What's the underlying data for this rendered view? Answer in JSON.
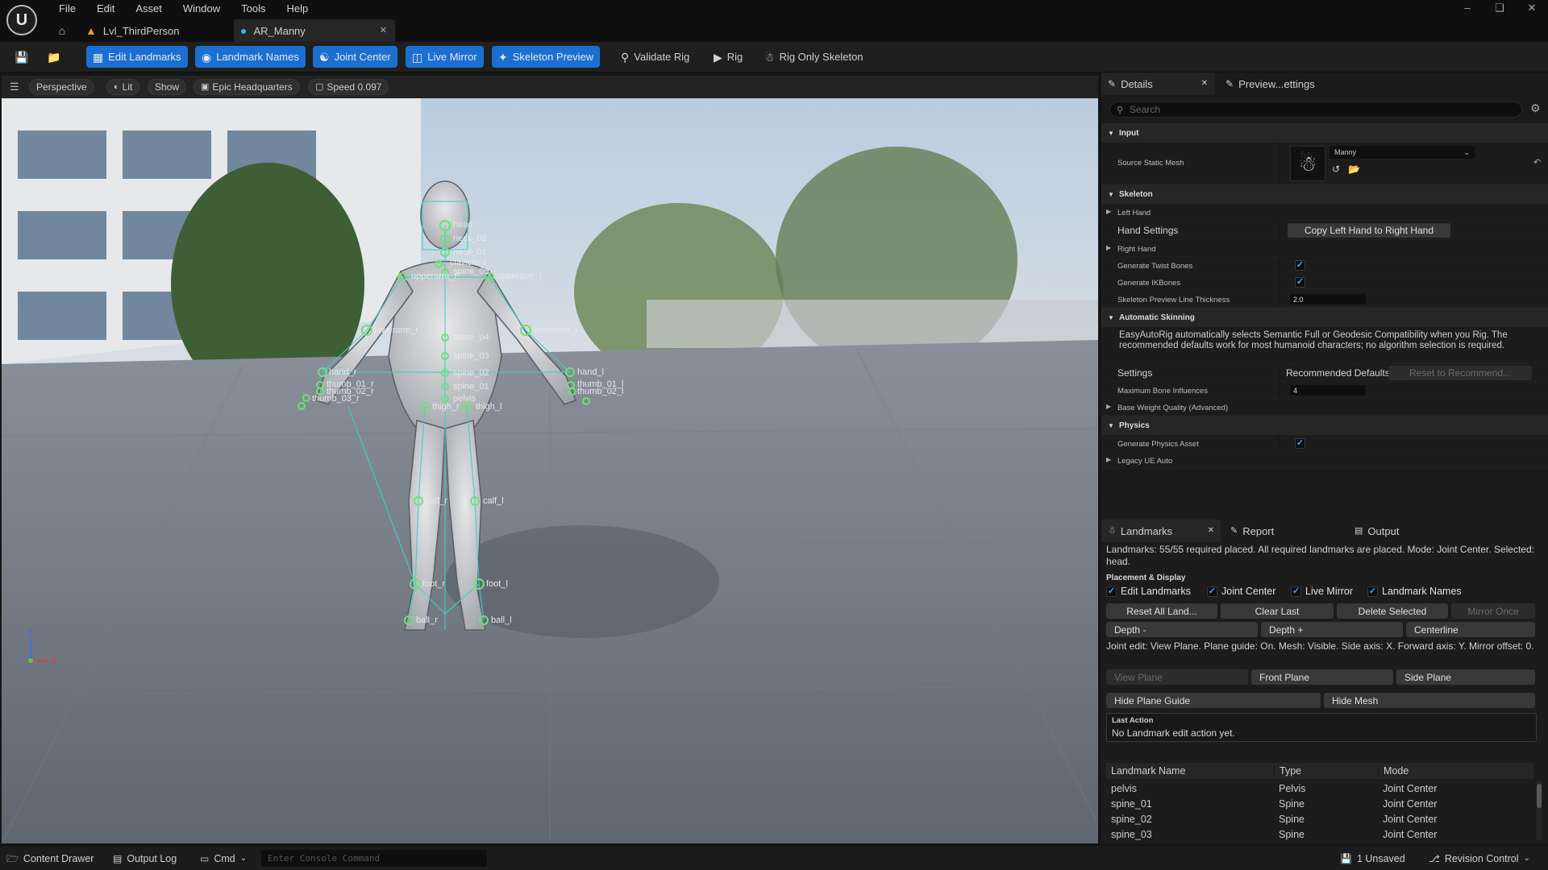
{
  "titlebar": {
    "menu": [
      "File",
      "Edit",
      "Asset",
      "Window",
      "Tools",
      "Help"
    ],
    "tabs": [
      {
        "label": "Lvl_ThirdPerson",
        "icon": "level-icon"
      },
      {
        "label": "AR_Manny",
        "icon": "asset-icon"
      }
    ]
  },
  "toolbar": {
    "edit_landmarks": "Edit Landmarks",
    "landmark_names": "Landmark Names",
    "joint_center": "Joint Center",
    "live_mirror": "Live Mirror",
    "skeleton_preview": "Skeleton Preview",
    "validate_rig": "Validate Rig",
    "rig": "Rig",
    "rig_only_skeleton": "Rig Only Skeleton"
  },
  "viewport": {
    "perspective": "Perspective",
    "lit": "Lit",
    "show": "Show",
    "environment": "Epic Headquarters",
    "speed": "Speed 0.097",
    "axis_z": "Z",
    "axis_x": "X",
    "landmarks": [
      {
        "name": "head"
      },
      {
        "name": "neck_02"
      },
      {
        "name": "neck_01"
      },
      {
        "name": "clavicle_l"
      },
      {
        "name": "spine_05"
      },
      {
        "name": "upperarm_r"
      },
      {
        "name": "upperarm_l"
      },
      {
        "name": "lowerarm_r"
      },
      {
        "name": "lowerarm_l"
      },
      {
        "name": "spine_04"
      },
      {
        "name": "spine_03"
      },
      {
        "name": "spine_02"
      },
      {
        "name": "spine_01"
      },
      {
        "name": "pelvis"
      },
      {
        "name": "hand_r"
      },
      {
        "name": "hand_l"
      },
      {
        "name": "thumb_01_r"
      },
      {
        "name": "thumb_02_r"
      },
      {
        "name": "thumb_03_r"
      },
      {
        "name": "thumb_01_l"
      },
      {
        "name": "thumb_02_l"
      },
      {
        "name": "thigh_r"
      },
      {
        "name": "thigh_l"
      },
      {
        "name": "calf_r"
      },
      {
        "name": "calf_l"
      },
      {
        "name": "foot_r"
      },
      {
        "name": "foot_l"
      },
      {
        "name": "ball_r"
      },
      {
        "name": "ball_l"
      }
    ]
  },
  "details": {
    "tab_details": "Details",
    "tab_preview": "Preview...ettings",
    "search_placeholder": "Search",
    "input_section": "Input",
    "source_static_mesh": "Source Static Mesh",
    "mesh_value": "Manny",
    "skeleton_section": "Skeleton",
    "left_hand": "Left Hand",
    "hand_settings": "Hand Settings",
    "copy_hand": "Copy Left Hand to Right Hand",
    "right_hand": "Right Hand",
    "generate_twist": "Generate Twist Bones",
    "generate_twist_checked": true,
    "generate_ik": "Generate IKBones",
    "generate_ik_checked": true,
    "line_thickness_label": "Skeleton Preview Line Thickness",
    "line_thickness_value": "2.0",
    "auto_skinning_section": "Automatic Skinning",
    "auto_skinning_text": "EasyAutoRig automatically selects Semantic Full or Geodesic Compatibility when you Rig. The recommended defaults work for most humanoid characters; no algorithm selection is required.",
    "settings": "Settings",
    "recommended_defaults": "Recommended Defaults",
    "reset_recommend": "Reset to Recommend...",
    "max_bone_influences_label": "Maximum Bone Influences",
    "max_bone_influences_value": "4",
    "base_weight_quality": "Base Weight Quality (Advanced)",
    "physics_section": "Physics",
    "generate_physics": "Generate Physics Asset",
    "generate_physics_checked": true,
    "legacy_ue_auto": "Legacy UE Auto"
  },
  "landmarks_panel": {
    "tab_landmarks": "Landmarks",
    "tab_report": "Report",
    "tab_output": "Output",
    "status": "Landmarks: 55/55 required placed. All required landmarks are placed. Mode: Joint Center. Selected: head.",
    "placement_display": "Placement & Display",
    "cb_edit_landmarks": "Edit Landmarks",
    "cb_joint_center": "Joint Center",
    "cb_live_mirror": "Live Mirror",
    "cb_landmark_names": "Landmark Names",
    "reset_all": "Reset All Land...",
    "clear_last": "Clear Last",
    "delete_selected": "Delete Selected",
    "mirror_once": "Mirror Once",
    "depth_minus": "Depth -",
    "depth_plus": "Depth +",
    "centerline": "Centerline",
    "joint_edit_text": "Joint edit: View Plane. Plane guide: On. Mesh: Visible. Side axis: X. Forward axis: Y. Mirror offset: 0.",
    "view_plane": "View Plane",
    "front_plane": "Front Plane",
    "side_plane": "Side Plane",
    "hide_plane_guide": "Hide Plane Guide",
    "hide_mesh": "Hide Mesh",
    "last_action_label": "Last Action",
    "last_action_value": "No Landmark edit action yet.",
    "columns": [
      "Landmark Name",
      "Type",
      "Mode"
    ],
    "rows": [
      [
        "pelvis",
        "Pelvis",
        "Joint Center"
      ],
      [
        "spine_01",
        "Spine",
        "Joint Center"
      ],
      [
        "spine_02",
        "Spine",
        "Joint Center"
      ],
      [
        "spine_03",
        "Spine",
        "Joint Center"
      ]
    ]
  },
  "statusbar": {
    "content_drawer": "Content Drawer",
    "output_log": "Output Log",
    "cmd": "Cmd",
    "console_placeholder": "Enter Console Command",
    "unsaved": "1 Unsaved",
    "revision_control": "Revision Control"
  }
}
